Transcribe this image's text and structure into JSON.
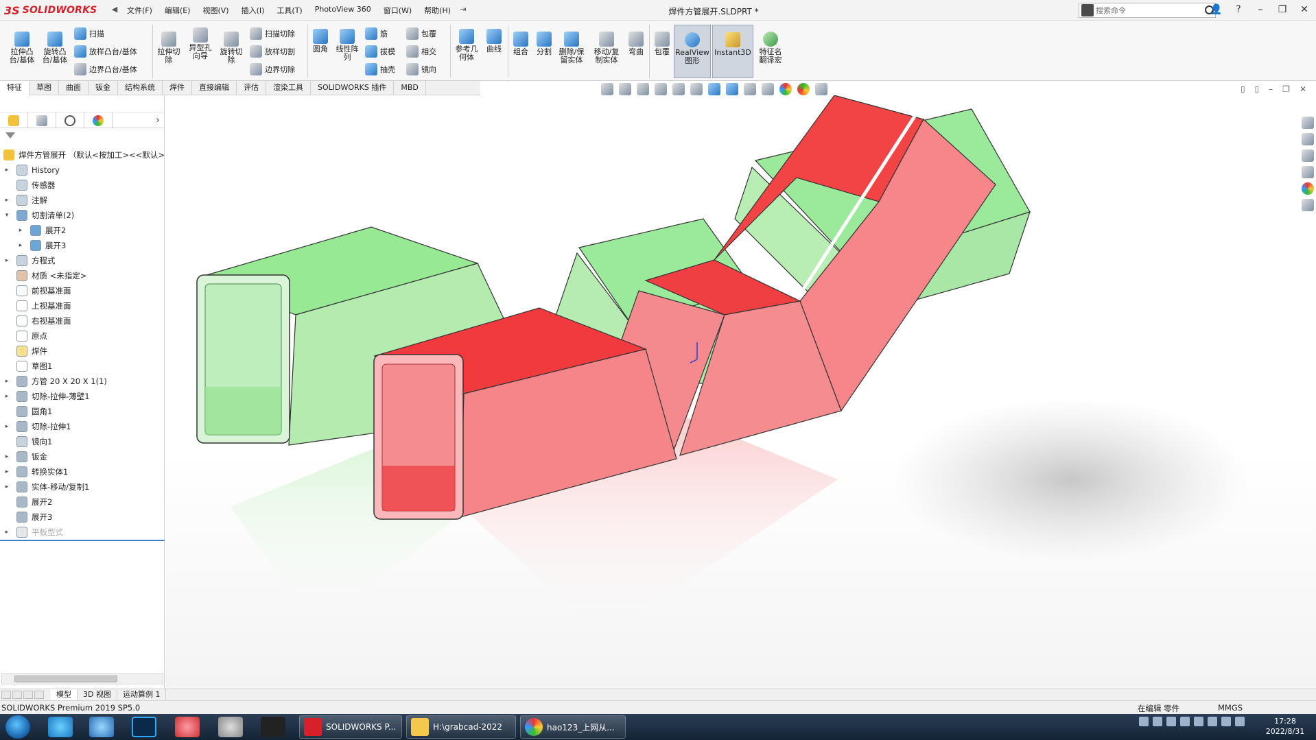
{
  "app": {
    "brand": "SOLIDWORKS",
    "document_title": "焊件方管展开.SLDPRT *",
    "search_placeholder": "搜索命令",
    "menu": [
      "文件(F)",
      "编辑(E)",
      "视图(V)",
      "插入(I)",
      "工具(T)",
      "PhotoView 360",
      "窗口(W)",
      "帮助(H)"
    ]
  },
  "toolbar": {
    "extrude_boss": "拉伸凸\n台/基体",
    "revolve_boss": "旋转凸\n台/基体",
    "sweep": "扫描",
    "loft": "放样凸台/基体",
    "boundary_boss": "边界凸台/基体",
    "extrude_cut": "拉伸切\n除",
    "hole_wizard": "异型孔\n向导",
    "revolve_cut": "旋转切\n除",
    "sweep_cut": "扫描切除",
    "loft_cut": "放样切割",
    "boundary_cut": "边界切除",
    "fillet": "圆角",
    "linear_pattern": "线性阵\n列",
    "rib": "筋",
    "draft": "拔模",
    "shell": "抽壳",
    "wrap": "包覆",
    "intersect": "相交",
    "mirror": "镜向",
    "ref_geometry": "参考几\n何体",
    "curves": "曲线",
    "combine": "组合",
    "split": "分割",
    "delete_body": "删除/保\n留实体",
    "move_copy": "移动/复\n制实体",
    "flex": "弯曲",
    "wrap2": "包覆",
    "realview": "RealView\n图形",
    "instant3d": "Instant3D",
    "feature_translate": "特征名\n翻译宏"
  },
  "tabs": [
    "特征",
    "草图",
    "曲面",
    "钣金",
    "结构系统",
    "焊件",
    "直接编辑",
    "评估",
    "渲染工具",
    "SOLIDWORKS 插件",
    "MBD"
  ],
  "tree": {
    "root": "焊件方管展开 （默认<按加工><<默认>",
    "items": [
      {
        "label": "History",
        "expand": "▸",
        "indent": 0
      },
      {
        "label": "传感器",
        "expand": "",
        "indent": 0
      },
      {
        "label": "注解",
        "expand": "▸",
        "indent": 0
      },
      {
        "label": "切割清单(2)",
        "expand": "▾",
        "indent": 0
      },
      {
        "label": "展开2",
        "expand": "▸",
        "indent": 1
      },
      {
        "label": "展开3",
        "expand": "▸",
        "indent": 1
      },
      {
        "label": "方程式",
        "expand": "▸",
        "indent": 0
      },
      {
        "label": "材质 <未指定>",
        "expand": "",
        "indent": 0
      },
      {
        "label": "前视基准面",
        "expand": "",
        "indent": 0
      },
      {
        "label": "上视基准面",
        "expand": "",
        "indent": 0
      },
      {
        "label": "右视基准面",
        "expand": "",
        "indent": 0
      },
      {
        "label": "原点",
        "expand": "",
        "indent": 0
      },
      {
        "label": "焊件",
        "expand": "",
        "indent": 0
      },
      {
        "label": "草图1",
        "expand": "",
        "indent": 0
      },
      {
        "label": "方管 20 X 20 X 1(1)",
        "expand": "▸",
        "indent": 0
      },
      {
        "label": "切除-拉伸-薄壁1",
        "expand": "▸",
        "indent": 0
      },
      {
        "label": "圆角1",
        "expand": "",
        "indent": 0
      },
      {
        "label": "切除-拉伸1",
        "expand": "▸",
        "indent": 0
      },
      {
        "label": "镜向1",
        "expand": "",
        "indent": 0
      },
      {
        "label": "钣金",
        "expand": "▸",
        "indent": 0
      },
      {
        "label": "转换实体1",
        "expand": "▸",
        "indent": 0
      },
      {
        "label": "实体-移动/复制1",
        "expand": "▸",
        "indent": 0
      },
      {
        "label": "展开2",
        "expand": "",
        "indent": 0
      },
      {
        "label": "展开3",
        "expand": "",
        "indent": 0
      },
      {
        "label": "平板型式",
        "expand": "▸",
        "indent": 0,
        "dim": true
      }
    ]
  },
  "bottom_tabs": [
    "模型",
    "3D 视图",
    "运动算例 1"
  ],
  "status": {
    "product": "SOLIDWORKS Premium 2019 SP5.0",
    "mode": "在编辑 零件",
    "units": "MMGS"
  },
  "taskbar": {
    "items": [
      "SOLIDWORKS P...",
      "H:\\grabcad-2022",
      "hao123_上网从..."
    ],
    "time": "17:28",
    "date": "2022/8/31"
  },
  "colors": {
    "green_body": "#8ee88a",
    "red_body": "#f0454a",
    "accent": "#d8202b"
  }
}
